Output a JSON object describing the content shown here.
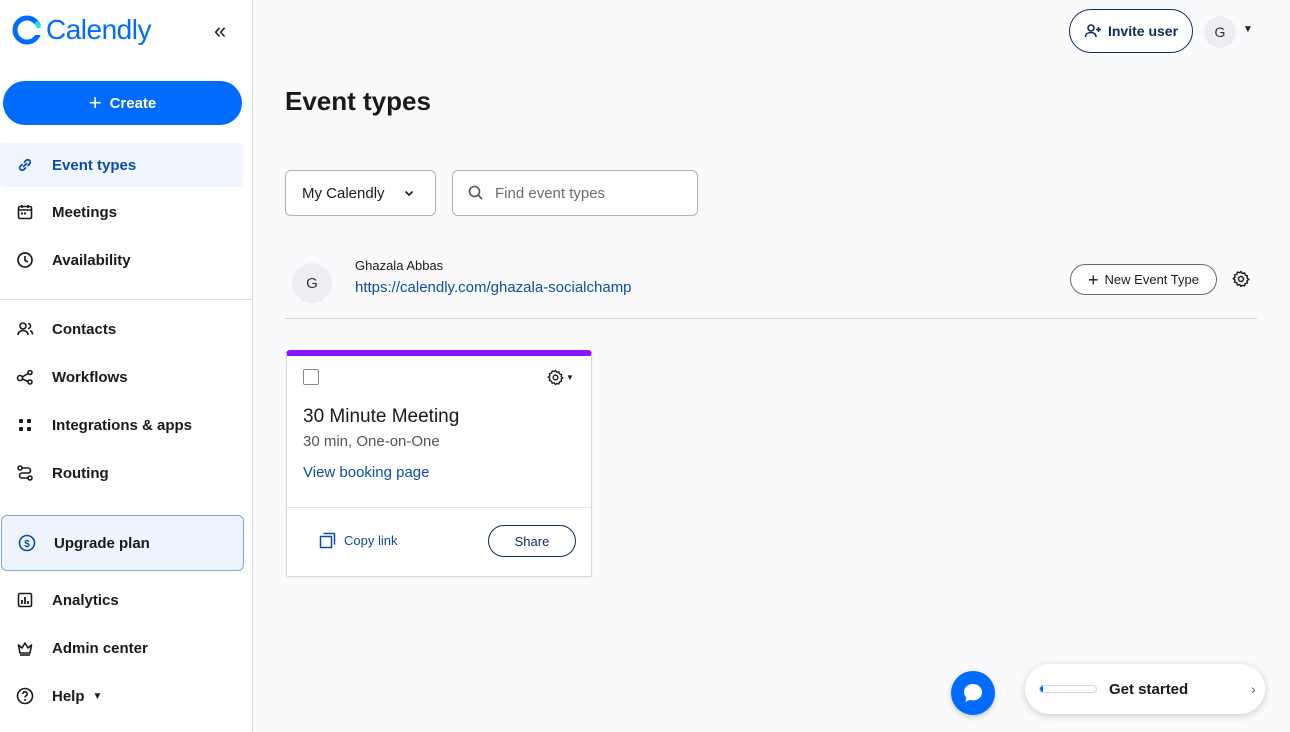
{
  "app": {
    "name": "Calendly"
  },
  "sidebar": {
    "create_label": "Create",
    "items": [
      {
        "label": "Event types",
        "icon": "link-icon"
      },
      {
        "label": "Meetings",
        "icon": "calendar-icon"
      },
      {
        "label": "Availability",
        "icon": "clock-icon"
      },
      {
        "label": "Contacts",
        "icon": "contacts-icon"
      },
      {
        "label": "Workflows",
        "icon": "workflow-icon"
      },
      {
        "label": "Integrations & apps",
        "icon": "apps-grid-icon"
      },
      {
        "label": "Routing",
        "icon": "routing-icon"
      },
      {
        "label": "Upgrade plan",
        "icon": "dollar-icon"
      },
      {
        "label": "Analytics",
        "icon": "analytics-icon"
      },
      {
        "label": "Admin center",
        "icon": "crown-icon"
      },
      {
        "label": "Help",
        "icon": "help-icon"
      }
    ]
  },
  "header": {
    "invite_label": "Invite user",
    "avatar_initial": "G"
  },
  "main": {
    "title": "Event types",
    "calendar_select": "My Calendly",
    "search_placeholder": "Find event types",
    "user": {
      "initial": "G",
      "name": "Ghazala Abbas",
      "link": "https://calendly.com/ghazala-socialchamp"
    },
    "new_event_label": "New Event Type",
    "card": {
      "accent_color": "#8a16ff",
      "title": "30 Minute Meeting",
      "subtitle": "30 min, One-on-One",
      "view_link": "View booking page",
      "copy_link": "Copy link",
      "share": "Share"
    }
  },
  "onboarding": {
    "label": "Get started",
    "progress": 0.05
  },
  "colors": {
    "brand": "#006bff"
  }
}
